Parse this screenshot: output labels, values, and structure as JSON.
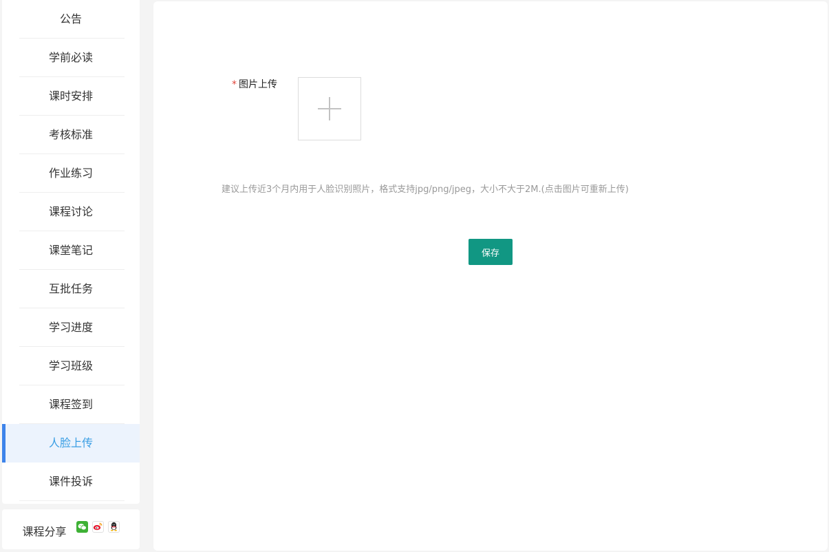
{
  "sidebar": {
    "items": [
      {
        "label": "公告"
      },
      {
        "label": "学前必读"
      },
      {
        "label": "课时安排"
      },
      {
        "label": "考核标准"
      },
      {
        "label": "作业练习"
      },
      {
        "label": "课程讨论"
      },
      {
        "label": "课堂笔记"
      },
      {
        "label": "互批任务"
      },
      {
        "label": "学习进度"
      },
      {
        "label": "学习班级"
      },
      {
        "label": "课程签到"
      },
      {
        "label": "人脸上传"
      },
      {
        "label": "课件投诉"
      }
    ],
    "active_item": "人脸上传"
  },
  "share": {
    "label": "课程分享",
    "icons": [
      "wechat-icon",
      "weibo-icon",
      "qq-icon"
    ]
  },
  "form": {
    "required_mark": "*",
    "upload_label": "图片上传",
    "upload_icon": "plus-icon",
    "hint": "建议上传近3个月内用于人脸识别照片，格式支持jpg/png/jpeg，大小不大于2M.(点击图片可重新上传)",
    "save_label": "保存"
  },
  "colors": {
    "accent": "#3d83ea",
    "active_text": "#3a9ee4",
    "active_bg": "#ecf3fd",
    "save_button": "#119783",
    "required": "#e0453a"
  }
}
